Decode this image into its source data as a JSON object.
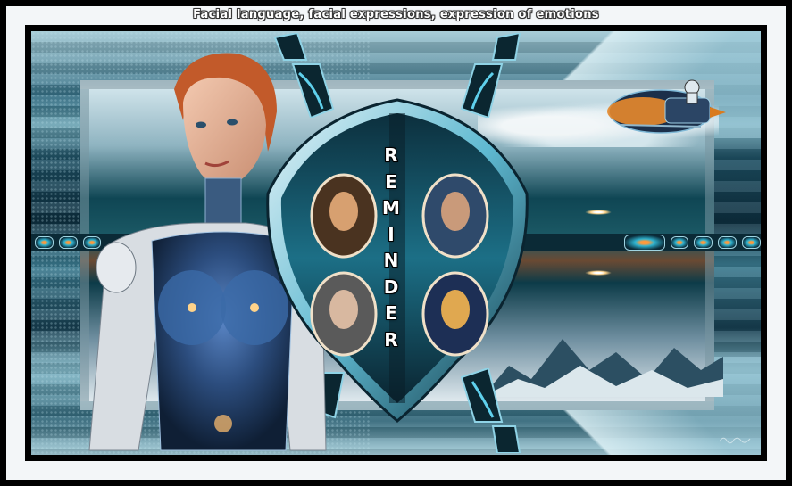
{
  "title": "Facial language, facial expressions, expression of emotions",
  "emblem": {
    "letters": [
      "R",
      "E",
      "M",
      "I",
      "N",
      "D",
      "E",
      "R"
    ]
  },
  "colors": {
    "frame": "#000000",
    "band": "#f3f6f8",
    "teal": "#2f7f94",
    "accent_orange": "#e8892b"
  },
  "icons": {
    "woman": "cyborg-woman-figure",
    "ship": "spaceship-illustration",
    "portraits": [
      "portrait-top-left",
      "portrait-top-right",
      "portrait-bottom-left",
      "portrait-bottom-right"
    ]
  }
}
